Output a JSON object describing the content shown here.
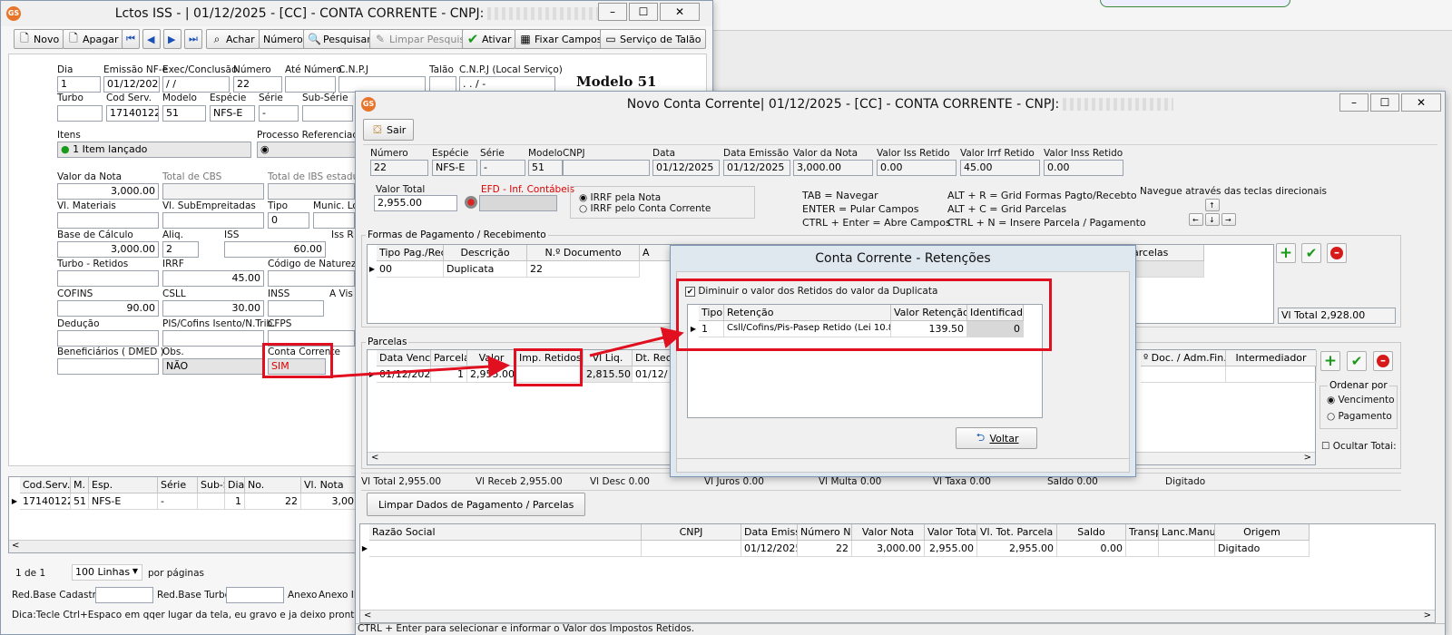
{
  "back": {
    "title": "Lctos ISS - |  01/12/2025 - [CC] - CONTA CORRENTE - CNPJ:",
    "toolbar": [
      "Novo",
      "Apagar",
      "Achar",
      "Número",
      "Pesquisar",
      "Limpar Pesquisa",
      "Ativar",
      "Fixar Campos",
      "Serviço de Talão"
    ],
    "labels": {
      "dia": "Dia",
      "emissao": "Emissão NF-e",
      "exec": "Exec/Conclusão",
      "numero": "Número",
      "ate_numero": "Até Número",
      "cnpj": "C.N.P.J",
      "talao": "Talão",
      "cnpj_local": "C.N.P.J (Local Serviço)",
      "turbo": "Turbo",
      "cod_serv": "Cod Serv.",
      "modelo": "Modelo",
      "especie": "Espécie",
      "serie": "Série",
      "sub_serie": "Sub-Série",
      "itens": "Itens",
      "processo": "Processo Referenciado",
      "valor_nota": "Valor da Nota",
      "total_cbs": "Total de CBS",
      "total_ibs": "Total de IBS estadu",
      "vl_materiais": "Vl. Materiais",
      "vl_sub": "Vl. SubEmpreitadas",
      "tipo": "Tipo",
      "munic": "Munic. Lo",
      "base_calc": "Base de Cálculo",
      "aliq": "Aliq.",
      "iss": "ISS",
      "iss_r": "Iss R",
      "turbo_ret": "Turbo - Retidos",
      "irrf": "IRRF",
      "cod_natureza": "Código de Natureza",
      "cofins": "COFINS",
      "csll": "CSLL",
      "inss": "INSS",
      "a_vis": "A Vis",
      "deducao": "Dedução",
      "pis_cofins": "PIS/Cofins Isento/N.Trib.",
      "cfps": "CFPS",
      "beneficiarios": "Beneficiários ( DMED )",
      "obs": "Obs.",
      "conta_corrente": "Conta Corrente"
    },
    "values": {
      "dia": "1",
      "emissao": "01/12/2025",
      "exec": " /  /",
      "numero": "22",
      "cnpj_local": " .  .  /  -",
      "turbo": "",
      "cod_serv": "171401220",
      "modelo": "51",
      "especie": "NFS-E",
      "serie": "-",
      "itens": "1 Item lançado",
      "valor_nota": "3,000.00",
      "tipo": "0",
      "base_calc": "3,000.00",
      "aliq": "2",
      "iss": "60.00",
      "irrf": "45.00",
      "cofins": "90.00",
      "csll": "30.00",
      "obs": "NÃO",
      "conta_corrente": "SIM"
    },
    "modelo_title": "Modelo 51",
    "grid_headers": [
      "Cod.Serv.",
      "M.",
      "Esp.",
      "Série",
      "Sub-S",
      "Dia",
      "No.",
      "Vl. Nota"
    ],
    "grid_row": [
      "171401220",
      "51",
      "NFS-E",
      "-",
      "",
      "1",
      "22",
      "3,00"
    ],
    "paging": {
      "of": "1  de  1",
      "lines": "100 Linhas",
      "per": "por páginas"
    },
    "footer_labels": [
      "Red.Base Cadastro",
      "Red.Base Turbo",
      "Anexo",
      "Anexo II"
    ],
    "tip": "Dica:Tecle Ctrl+Espaco em qqer lugar da tela, eu gravo  e ja deixo pronto p/ d"
  },
  "front": {
    "title": "Novo Conta Corrente|  01/12/2025 - [CC] - CONTA CORRENTE - CNPJ:",
    "sair": "Sair",
    "head_labels": [
      "Número",
      "Espécie",
      "Série",
      "Modelo",
      "CNPJ",
      "Data",
      "Data Emissão",
      "Valor da Nota",
      "Valor Iss Retido",
      "Valor Irrf Retido",
      "Valor Inss Retido"
    ],
    "head_values": [
      "22",
      "NFS-E",
      "-",
      "51",
      "",
      "01/12/2025",
      "01/12/2025",
      "3,000.00",
      "0.00",
      "45.00",
      "0.00"
    ],
    "valor_total_label": "Valor Total",
    "valor_total": "2,955.00",
    "efd_label": "EFD - Inf. Contábeis",
    "radio1": "IRRF pela Nota",
    "radio2": "IRRF pelo Conta Corrente",
    "shortcuts": [
      "TAB = Navegar",
      "ENTER = Pular Campos",
      "CTRL + Enter = Abre Campos",
      "ALT + R = Grid Formas Pagto/Recebto",
      "ALT + C = Grid Parcelas",
      "CTRL + N = Insere Parcela / Pagamento"
    ],
    "navegue": "Navegue através das teclas direcionais",
    "formas_title": "Formas de Pagamento / Recebimento",
    "formas_headers": [
      "Tipo Pag./Rec.",
      "Descrição",
      "N.º Documento",
      "A"
    ],
    "formas_row": [
      "00",
      "Duplicata",
      "22"
    ],
    "parcelas_hdr_right": "arcelas",
    "vl_total_right": "Vl Total  2,928.00",
    "parcelas_title": "Parcelas",
    "parcelas_headers": [
      "Data Venc.",
      "Parcela",
      "Valor",
      "Imp. Retidos",
      "Vl Liq.",
      "Dt. Rece"
    ],
    "parcelas_row": [
      "01/12/2025",
      "1",
      "2,955.00",
      "",
      "2,815.50",
      "01/12/"
    ],
    "parcelas_right_headers": [
      "º Doc. / Adm.Fin.",
      "Intermediador"
    ],
    "ordenar": "Ordenar por",
    "venc": "Vencimento",
    "pag": "Pagamento",
    "ocultar": "Ocultar Totai:",
    "totals": [
      "Vl Total  2,955.00",
      "Vl Receb  2,955.00",
      "Vl Desc  0.00",
      "Vl Juros  0.00",
      "Vl Multa  0.00",
      "Vl Taxa  0.00",
      "Saldo  0.00",
      "Digitado"
    ],
    "limpar": "Limpar Dados de Pagamento / Parcelas",
    "bottom_headers": [
      "Razão Social",
      "CNPJ",
      "Data Emissão",
      "Número NF",
      "Valor Nota",
      "Valor Total",
      "Vl. Tot. Parcela",
      "Saldo",
      "Transp",
      "Lanc.Manual",
      "Origem"
    ],
    "bottom_row": [
      "",
      "",
      "01/12/2025",
      "22",
      "3,000.00",
      "2,955.00",
      "2,955.00",
      "0.00",
      "",
      "",
      "Digitado"
    ],
    "status": "CTRL + Enter para selecionar e informar o Valor dos Impostos Retidos."
  },
  "dialog": {
    "title": "Conta Corrente - Retenções",
    "checkbox": "Diminuir o valor dos Retidos do valor da Duplicata",
    "headers": [
      "Tipo",
      "Retenção",
      "Valor Retenção",
      "Identificador"
    ],
    "row": [
      "1",
      "Csll/Cofins/Pis-Pasep Retido (Lei 10.833)",
      "139.50",
      "0"
    ],
    "voltar": "Voltar"
  }
}
